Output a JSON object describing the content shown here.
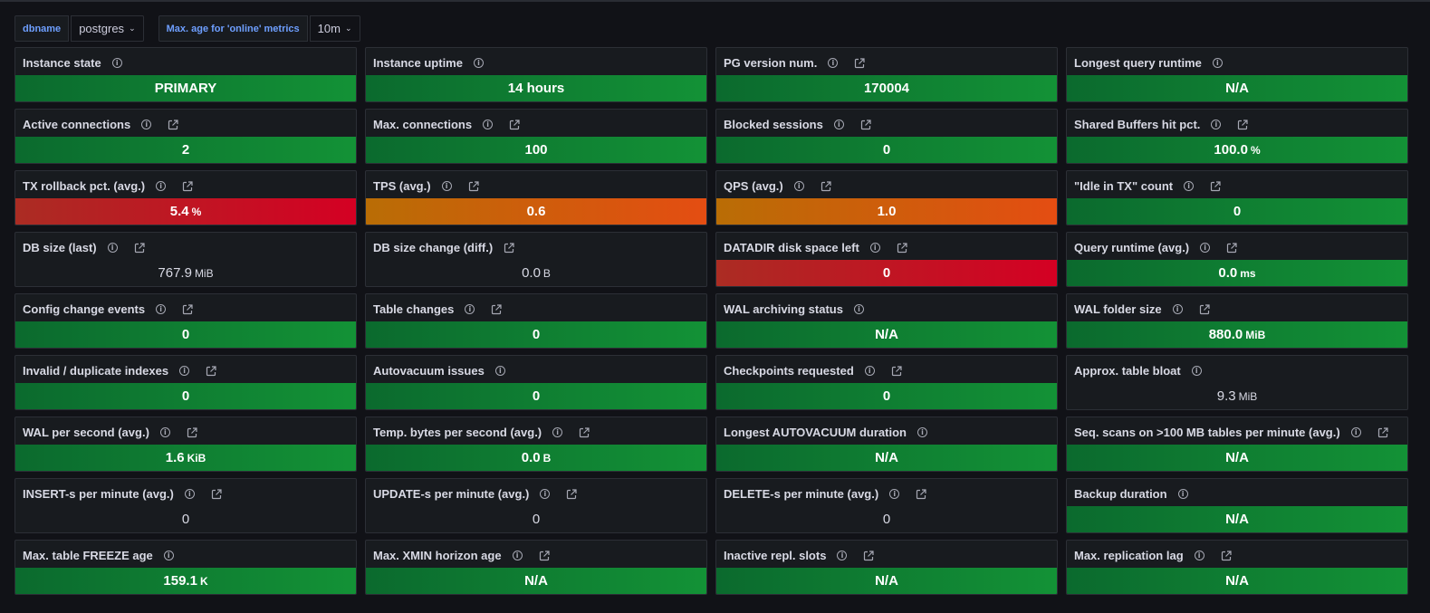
{
  "variables": [
    {
      "label": "dbname",
      "value": "postgres"
    },
    {
      "label": "Max. age for 'online' metrics",
      "value": "10m"
    }
  ],
  "colors": {
    "green": "#139236",
    "orange": "#e44d12",
    "red": "#d40023"
  },
  "panels": [
    {
      "title": "Instance state",
      "value": "PRIMARY",
      "unit": "",
      "color": "green",
      "link": false
    },
    {
      "title": "Instance uptime",
      "value": "14 hours",
      "unit": "",
      "color": "green",
      "link": false
    },
    {
      "title": "PG version num.",
      "value": "170004",
      "unit": "",
      "color": "green",
      "link": true
    },
    {
      "title": "Longest query runtime",
      "value": "N/A",
      "unit": "",
      "color": "green",
      "link": false
    },
    {
      "title": "Active connections",
      "value": "2",
      "unit": "",
      "color": "green",
      "link": true
    },
    {
      "title": "Max. connections",
      "value": "100",
      "unit": "",
      "color": "green",
      "link": true
    },
    {
      "title": "Blocked sessions",
      "value": "0",
      "unit": "",
      "color": "green",
      "link": true
    },
    {
      "title": "Shared Buffers hit pct.",
      "value": "100.0",
      "unit": "%",
      "color": "green",
      "link": true
    },
    {
      "title": "TX rollback pct. (avg.)",
      "value": "5.4",
      "unit": "%",
      "color": "red",
      "link": true
    },
    {
      "title": "TPS (avg.)",
      "value": "0.6",
      "unit": "",
      "color": "orange",
      "link": true
    },
    {
      "title": "QPS (avg.)",
      "value": "1.0",
      "unit": "",
      "color": "orange",
      "link": true
    },
    {
      "title": "\"Idle in TX\" count",
      "value": "0",
      "unit": "",
      "color": "green",
      "link": true
    },
    {
      "title": "DB size (last)",
      "value": "767.9",
      "unit": "MiB",
      "color": "none",
      "link": true
    },
    {
      "title": "DB size change (diff.)",
      "value": "0.0",
      "unit": "B",
      "color": "none",
      "link": true,
      "noinfo": true
    },
    {
      "title": "DATADIR disk space left",
      "value": "0",
      "unit": "",
      "color": "red",
      "link": true
    },
    {
      "title": "Query runtime (avg.)",
      "value": "0.0",
      "unit": "ms",
      "color": "green",
      "link": true
    },
    {
      "title": "Config change events",
      "value": "0",
      "unit": "",
      "color": "green",
      "link": true
    },
    {
      "title": "Table changes",
      "value": "0",
      "unit": "",
      "color": "green",
      "link": true
    },
    {
      "title": "WAL archiving status",
      "value": "N/A",
      "unit": "",
      "color": "green",
      "link": false
    },
    {
      "title": "WAL folder size",
      "value": "880.0",
      "unit": "MiB",
      "color": "green",
      "link": true
    },
    {
      "title": "Invalid / duplicate indexes",
      "value": "0",
      "unit": "",
      "color": "green",
      "link": true
    },
    {
      "title": "Autovacuum issues",
      "value": "0",
      "unit": "",
      "color": "green",
      "link": false
    },
    {
      "title": "Checkpoints requested",
      "value": "0",
      "unit": "",
      "color": "green",
      "link": true
    },
    {
      "title": "Approx. table bloat",
      "value": "9.3",
      "unit": "MiB",
      "color": "none",
      "link": false
    },
    {
      "title": "WAL per second (avg.)",
      "value": "1.6",
      "unit": "KiB",
      "color": "green",
      "link": true
    },
    {
      "title": "Temp. bytes per second (avg.)",
      "value": "0.0",
      "unit": "B",
      "color": "green",
      "link": true
    },
    {
      "title": "Longest AUTOVACUUM duration",
      "value": "N/A",
      "unit": "",
      "color": "green",
      "link": false
    },
    {
      "title": "Seq. scans on >100 MB tables per minute (avg.)",
      "value": "N/A",
      "unit": "",
      "color": "green",
      "link": true
    },
    {
      "title": "INSERT-s per minute (avg.)",
      "value": "0",
      "unit": "",
      "color": "none",
      "link": true
    },
    {
      "title": "UPDATE-s per minute (avg.)",
      "value": "0",
      "unit": "",
      "color": "none",
      "link": true
    },
    {
      "title": "DELETE-s per minute (avg.)",
      "value": "0",
      "unit": "",
      "color": "none",
      "link": true
    },
    {
      "title": "Backup duration",
      "value": "N/A",
      "unit": "",
      "color": "green",
      "link": false
    },
    {
      "title": "Max. table FREEZE age",
      "value": "159.1",
      "unit": "K",
      "color": "green",
      "link": false
    },
    {
      "title": "Max. XMIN horizon age",
      "value": "N/A",
      "unit": "",
      "color": "green",
      "link": true
    },
    {
      "title": "Inactive repl. slots",
      "value": "N/A",
      "unit": "",
      "color": "green",
      "link": true
    },
    {
      "title": "Max. replication lag",
      "value": "N/A",
      "unit": "",
      "color": "green",
      "link": true
    }
  ]
}
